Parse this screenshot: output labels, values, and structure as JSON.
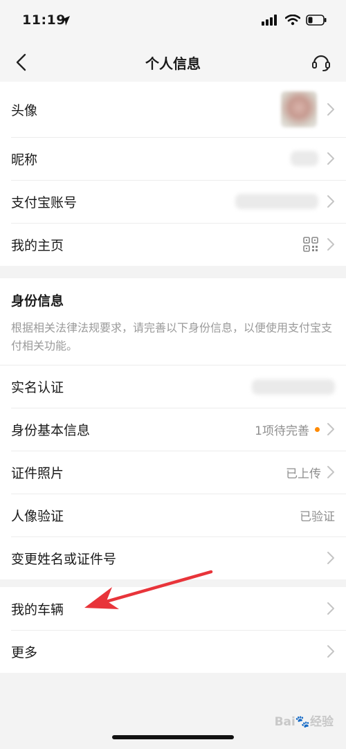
{
  "status": {
    "time": "11:19"
  },
  "nav": {
    "title": "个人信息"
  },
  "basic": {
    "avatar_label": "头像",
    "nickname_label": "昵称",
    "alipay_account_label": "支付宝账号",
    "homepage_label": "我的主页"
  },
  "identity": {
    "title": "身份信息",
    "description": "根据相关法律法规要求，请完善以下身份信息，以便使用支付宝支付相关功能。",
    "realname_label": "实名认证",
    "basic_info_label": "身份基本信息",
    "basic_info_value": "1项待完善",
    "id_photo_label": "证件照片",
    "id_photo_value": "已上传",
    "face_verify_label": "人像验证",
    "face_verify_value": "已验证",
    "change_name_label": "变更姓名或证件号"
  },
  "other": {
    "vehicle_label": "我的车辆",
    "more_label": "更多"
  },
  "watermark": "Bai🐾经验",
  "colors": {
    "accent_dot": "#ff8a00",
    "annotation_arrow": "#e8343a"
  }
}
